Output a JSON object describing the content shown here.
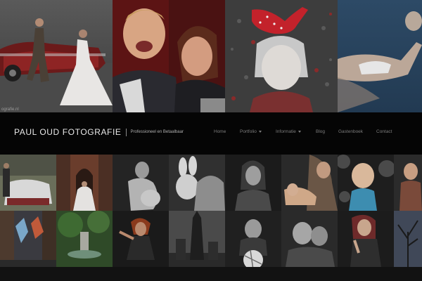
{
  "header": {
    "site_title": "PAUL OUD FOTOGRAFIE",
    "tagline": "Professioneel en Betaalbaar"
  },
  "hero": {
    "caption": "ografie.nl",
    "photos": [
      "wedding-car-photo",
      "mother-and-child-photo",
      "girl-with-red-shoe-photo",
      "floating-baby-photo"
    ]
  },
  "nav": {
    "items": [
      {
        "label": "Home",
        "has_dropdown": false
      },
      {
        "label": "Portfolio",
        "has_dropdown": true
      },
      {
        "label": "Informatie",
        "has_dropdown": true
      },
      {
        "label": "Blog",
        "has_dropdown": false
      },
      {
        "label": "Gastenboek",
        "has_dropdown": false
      },
      {
        "label": "Contact",
        "has_dropdown": false
      }
    ]
  },
  "gallery": {
    "tiles": [
      "wedding-couple-sofa-photo",
      "bride-church-gate-photo",
      "pregnancy-portrait-photo",
      "newborn-with-father-photo",
      "woman-portrait-bw-photo",
      "mother-holding-baby-photo",
      "toddler-blue-dress-photo",
      "bride-edge-photo",
      "jumping-women-photo",
      "garden-fountain-photo",
      "dancing-woman-photo",
      "church-tower-photo",
      "child-with-ball-photo",
      "couple-portrait-photo",
      "woman-pose-photo",
      "bare-tree-photo"
    ]
  },
  "colors": {
    "background": "#0d0d0d",
    "navbar": "#050505",
    "title_text": "#e8e8e8",
    "menu_text": "#7d7d7d"
  }
}
